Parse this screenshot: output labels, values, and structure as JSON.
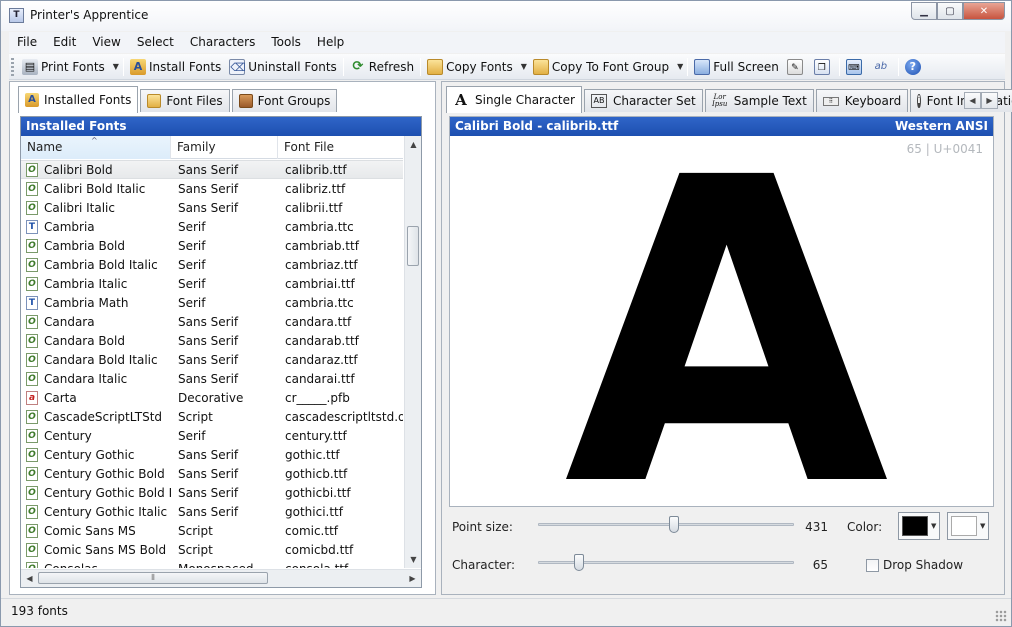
{
  "window": {
    "title": "Printer's Apprentice",
    "title_icon_glyph": "T"
  },
  "menu": [
    "File",
    "Edit",
    "View",
    "Select",
    "Characters",
    "Tools",
    "Help"
  ],
  "toolbar": {
    "print_fonts": "Print Fonts",
    "install_fonts": "Install Fonts",
    "uninstall_fonts": "Uninstall Fonts",
    "refresh": "Refresh",
    "copy_fonts": "Copy Fonts",
    "copy_to_font_group": "Copy To Font Group",
    "full_screen": "Full Screen"
  },
  "left_tabs": [
    "Installed Fonts",
    "Font Files",
    "Font Groups"
  ],
  "font_list": {
    "header": "Installed Fonts",
    "columns": [
      "Name",
      "Family",
      "Font File"
    ],
    "rows": [
      {
        "name": "Calibri Bold",
        "family": "Sans Serif",
        "file": "calibrib.ttf",
        "type": "otf",
        "selected": true
      },
      {
        "name": "Calibri Bold Italic",
        "family": "Sans Serif",
        "file": "calibriz.ttf",
        "type": "otf"
      },
      {
        "name": "Calibri Italic",
        "family": "Sans Serif",
        "file": "calibrii.ttf",
        "type": "otf"
      },
      {
        "name": "Cambria",
        "family": "Serif",
        "file": "cambria.ttc",
        "type": "ttf"
      },
      {
        "name": "Cambria Bold",
        "family": "Serif",
        "file": "cambriab.ttf",
        "type": "otf"
      },
      {
        "name": "Cambria Bold Italic",
        "family": "Serif",
        "file": "cambriaz.ttf",
        "type": "otf"
      },
      {
        "name": "Cambria Italic",
        "family": "Serif",
        "file": "cambriai.ttf",
        "type": "otf"
      },
      {
        "name": "Cambria Math",
        "family": "Serif",
        "file": "cambria.ttc",
        "type": "ttf"
      },
      {
        "name": "Candara",
        "family": "Sans Serif",
        "file": "candara.ttf",
        "type": "otf"
      },
      {
        "name": "Candara Bold",
        "family": "Sans Serif",
        "file": "candarab.ttf",
        "type": "otf"
      },
      {
        "name": "Candara Bold Italic",
        "family": "Sans Serif",
        "file": "candaraz.ttf",
        "type": "otf"
      },
      {
        "name": "Candara Italic",
        "family": "Sans Serif",
        "file": "candarai.ttf",
        "type": "otf"
      },
      {
        "name": "Carta",
        "family": "Decorative",
        "file": "cr_____.pfb",
        "type": "ps"
      },
      {
        "name": "CascadeScriptLTStd",
        "family": "Script",
        "file": "cascadescriptltstd.otf",
        "type": "otf"
      },
      {
        "name": "Century",
        "family": "Serif",
        "file": "century.ttf",
        "type": "otf"
      },
      {
        "name": "Century Gothic",
        "family": "Sans Serif",
        "file": "gothic.ttf",
        "type": "otf"
      },
      {
        "name": "Century Gothic Bold",
        "family": "Sans Serif",
        "file": "gothicb.ttf",
        "type": "otf"
      },
      {
        "name": "Century Gothic Bold I...",
        "family": "Sans Serif",
        "file": "gothicbi.ttf",
        "type": "otf"
      },
      {
        "name": "Century Gothic Italic",
        "family": "Sans Serif",
        "file": "gothici.ttf",
        "type": "otf"
      },
      {
        "name": "Comic Sans MS",
        "family": "Script",
        "file": "comic.ttf",
        "type": "otf"
      },
      {
        "name": "Comic Sans MS Bold",
        "family": "Script",
        "file": "comicbd.ttf",
        "type": "otf"
      },
      {
        "name": "Consolas",
        "family": "Monospaced",
        "file": "consola.ttf",
        "type": "otf"
      }
    ]
  },
  "right_tabs": [
    "Single Character",
    "Character Set",
    "Sample Text",
    "Keyboard",
    "Font Information"
  ],
  "preview": {
    "header_left": "Calibri Bold - calibrib.ttf",
    "header_right": "Western ANSI",
    "codepoint": "65 | U+0041",
    "glyph": "A"
  },
  "controls": {
    "point_size_label": "Point size:",
    "point_size_value": "431",
    "point_size_fraction": 0.53,
    "character_label": "Character:",
    "character_value": "65",
    "character_fraction": 0.16,
    "color_label": "Color:",
    "fg_color": "#000000",
    "bg_color": "#ffffff",
    "drop_shadow_label": "Drop Shadow"
  },
  "status": {
    "text": "193 fonts"
  }
}
